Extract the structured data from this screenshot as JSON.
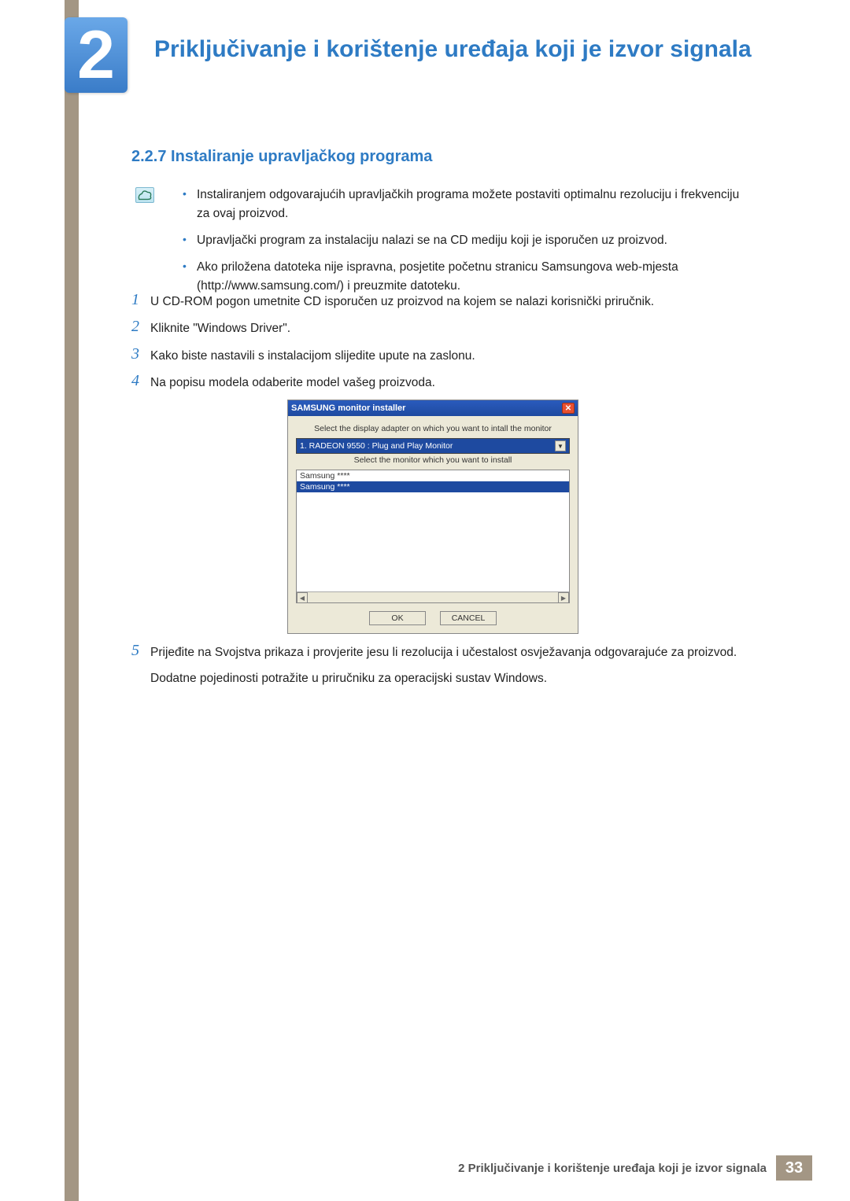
{
  "chapter": {
    "number": "2",
    "title": "Priključivanje i korištenje uređaja koji je izvor signala"
  },
  "section": {
    "number": "2.2.7",
    "title": "Instaliranje upravljačkog programa"
  },
  "notes": [
    "Instaliranjem odgovarajućih upravljačkih programa možete postaviti optimalnu rezoluciju i frekvenciju za ovaj proizvod.",
    "Upravljački program za instalaciju nalazi se na CD mediju koji je isporučen uz proizvod.",
    "Ako priložena datoteka nije ispravna, posjetite početnu stranicu Samsungova web-mjesta (http://www.samsung.com/) i preuzmite datoteku."
  ],
  "steps": {
    "s1": {
      "num": "1",
      "text": "U CD-ROM pogon umetnite CD isporučen uz proizvod na kojem se nalazi korisnički priručnik."
    },
    "s2": {
      "num": "2",
      "text": "Kliknite \"Windows Driver\"."
    },
    "s3": {
      "num": "3",
      "text": "Kako biste nastavili s instalacijom slijedite upute na zaslonu."
    },
    "s4": {
      "num": "4",
      "text": "Na popisu modela odaberite model vašeg proizvoda."
    },
    "s5": {
      "num": "5",
      "text": "Prijeđite na Svojstva prikaza i provjerite jesu li rezolucija i učestalost osvježavanja odgovarajuće za proizvod.",
      "extra": "Dodatne pojedinosti potražite u priručniku za operacijski sustav Windows."
    }
  },
  "dialog": {
    "title": "SAMSUNG monitor installer",
    "label1": "Select the display adapter on which you want to intall the monitor",
    "adapter": "1. RADEON 9550 : Plug and Play Monitor",
    "label2": "Select the monitor which you want to install",
    "list": {
      "item1": "Samsung ****",
      "item2": "Samsung ****"
    },
    "ok": "OK",
    "cancel": "CANCEL"
  },
  "footer": {
    "text": "2 Priključivanje i korištenje uređaja koji je izvor signala",
    "page": "33"
  }
}
